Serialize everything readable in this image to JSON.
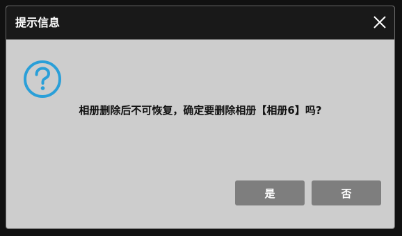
{
  "dialog": {
    "title": "提示信息",
    "message": "相册删除后不可恢复，确定要删除相册【相册6】吗?",
    "icon": "question-circle-icon",
    "close_icon": "close-icon",
    "accent_color": "#2a9fd8",
    "buttons": {
      "yes_label": "是",
      "no_label": "否"
    }
  }
}
